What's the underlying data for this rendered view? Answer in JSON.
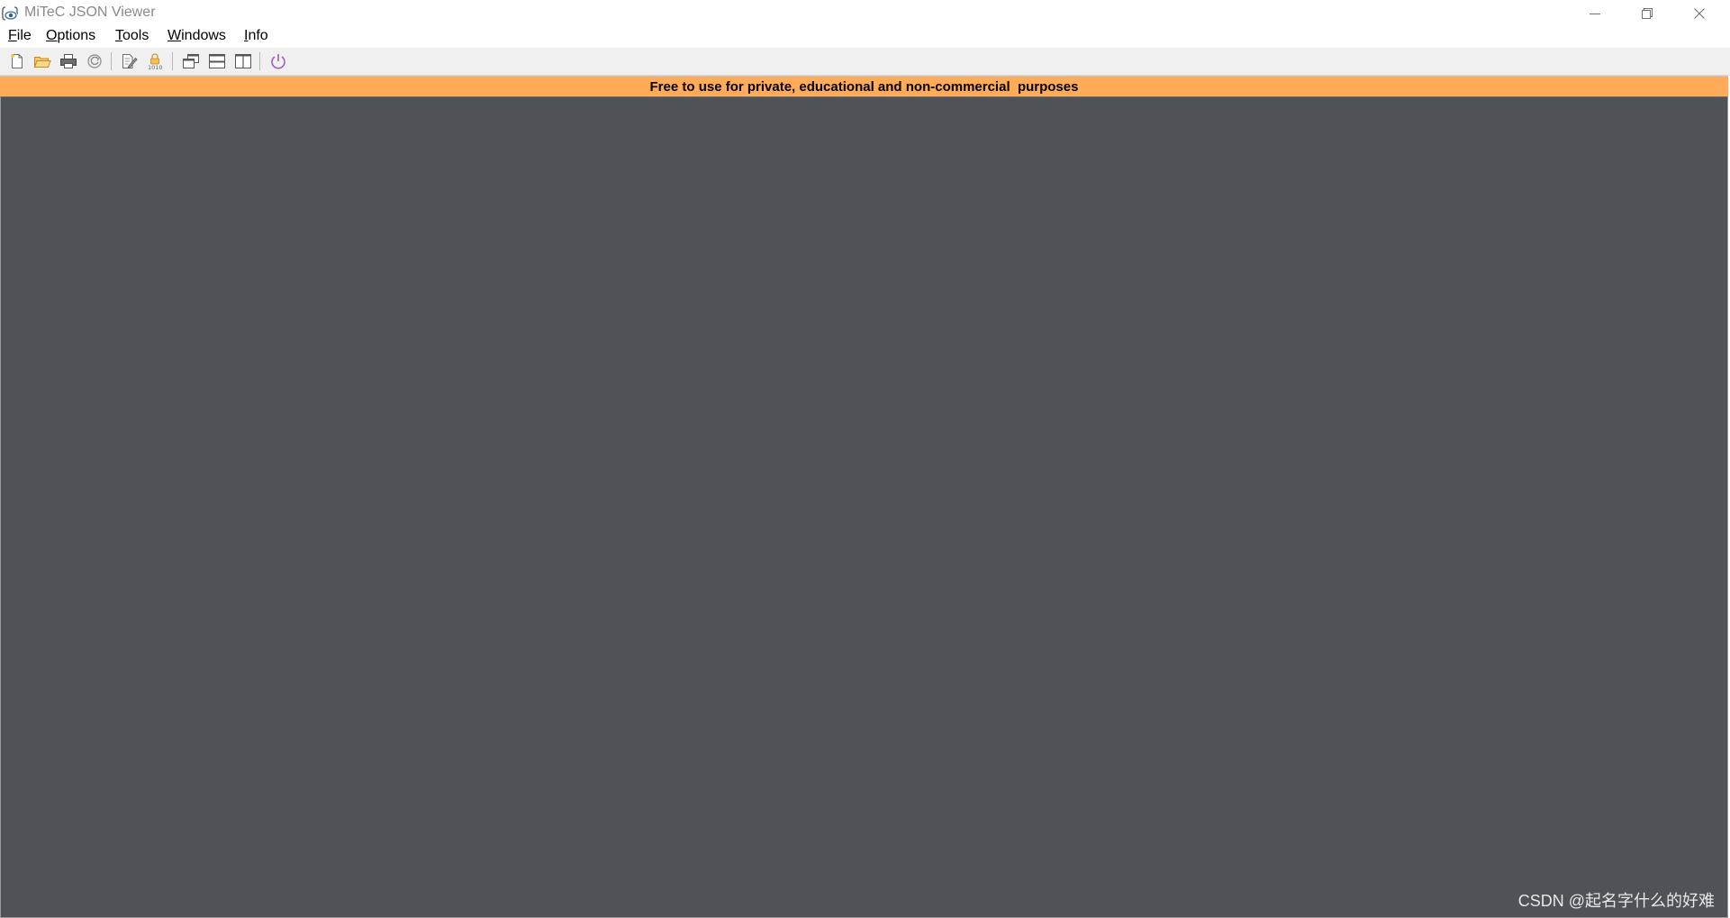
{
  "window": {
    "title": "MiTeC JSON Viewer",
    "app_icon": "json-viewer-app-icon",
    "controls": {
      "minimize_icon": "minimize-icon",
      "maximize_icon": "restore-icon",
      "close_icon": "close-icon"
    }
  },
  "menu": {
    "items": [
      {
        "accel": "F",
        "rest": "ile"
      },
      {
        "accel": "O",
        "rest": "ptions"
      },
      {
        "accel": "T",
        "rest": "ools"
      },
      {
        "accel": "W",
        "rest": "indows"
      },
      {
        "accel": "I",
        "rest": "nfo"
      }
    ]
  },
  "toolbar": {
    "groups": [
      [
        "new-file-icon",
        "open-folder-icon",
        "print-icon",
        "refresh-icon"
      ],
      [
        "edit-document-icon",
        "binary-lock-icon"
      ],
      [
        "cascade-windows-icon",
        "tile-horizontal-icon",
        "tile-vertical-icon"
      ],
      [
        "power-exit-icon"
      ]
    ]
  },
  "banner": {
    "text": "Free to use for private, educational and non-commercial  purposes",
    "color": "#ffab57"
  },
  "workspace": {
    "background": "#4f5257",
    "watermark": "CSDN @起名字什么的好难"
  }
}
